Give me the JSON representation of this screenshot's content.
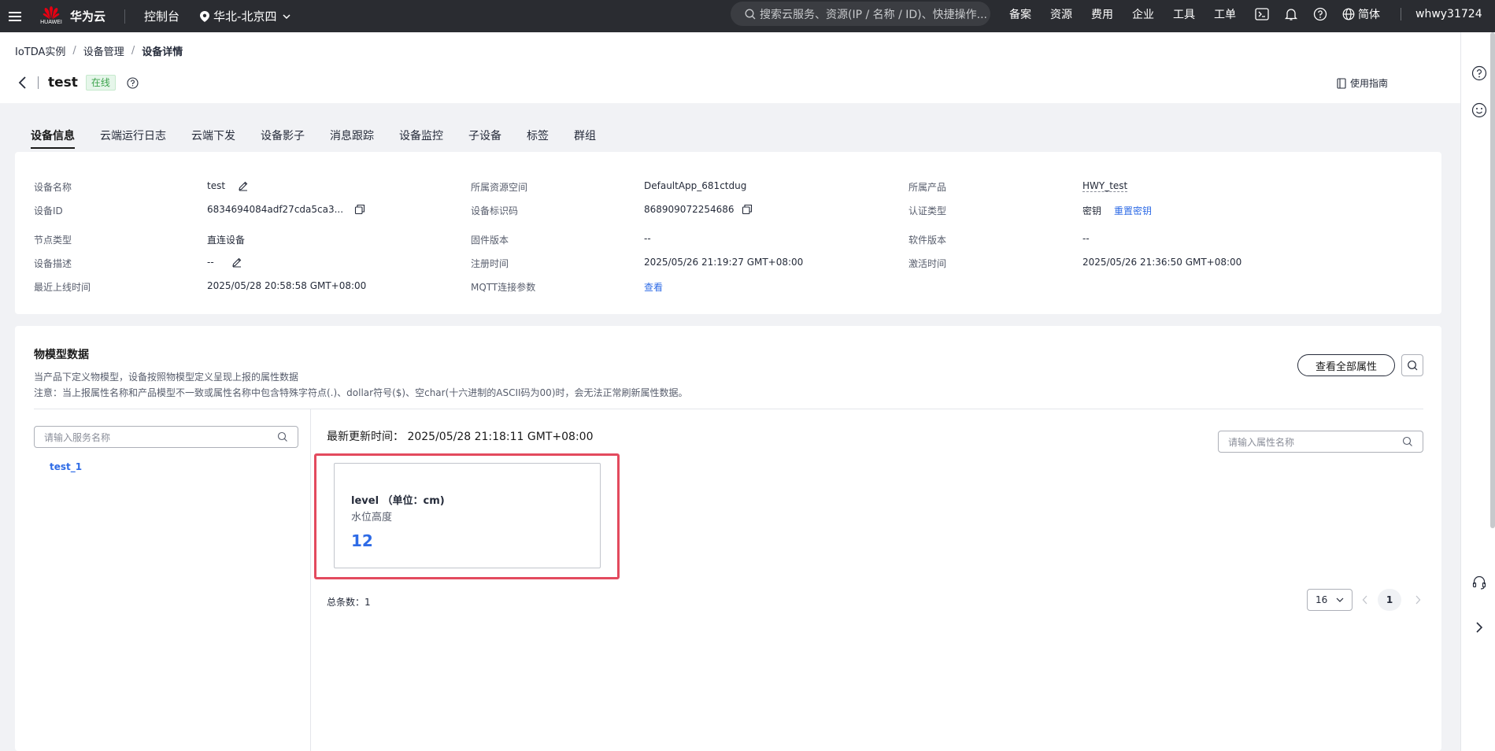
{
  "topbar": {
    "logo_sub": "HUAWEI",
    "logo_text": "华为云",
    "console": "控制台",
    "region": "华北-北京四",
    "search_placeholder": "搜索云服务、资源(IP / 名称 / ID)、快捷操作...",
    "links": [
      "备案",
      "资源",
      "费用",
      "企业",
      "工具",
      "工单"
    ],
    "lang": "简体",
    "user": "whwy31724"
  },
  "breadcrumb": [
    "IoTDA实例",
    "设备管理",
    "设备详情"
  ],
  "header": {
    "title": "test",
    "status": "在线",
    "guide": "使用指南"
  },
  "tabs": [
    "设备信息",
    "云端运行日志",
    "云端下发",
    "设备影子",
    "消息跟踪",
    "设备监控",
    "子设备",
    "标签",
    "群组"
  ],
  "device_info": {
    "name_label": "设备名称",
    "name": "test",
    "id_label": "设备ID",
    "id": "6834694084adf27cda5ca3...",
    "node_label": "节点类型",
    "node": "直连设备",
    "desc_label": "设备描述",
    "desc": "--",
    "last_online_label": "最近上线时间",
    "last_online": "2025/05/28 20:58:58 GMT+08:00",
    "space_label": "所属资源空间",
    "space": "DefaultApp_681ctdug",
    "ident_label": "设备标识码",
    "ident": "868909072254686",
    "fw_label": "固件版本",
    "fw": "--",
    "reg_label": "注册时间",
    "reg": "2025/05/26 21:19:27 GMT+08:00",
    "mqtt_label": "MQTT连接参数",
    "mqtt": "查看",
    "product_label": "所属产品",
    "product": "HWY_test",
    "auth_label": "认证类型",
    "auth": "密钥",
    "reset": "重置密钥",
    "sw_label": "软件版本",
    "sw": "--",
    "active_label": "激活时间",
    "active": "2025/05/26 21:36:50 GMT+08:00"
  },
  "model": {
    "title": "物模型数据",
    "desc": "当产品下定义物模型，设备按照物模型定义呈现上报的属性数据",
    "note": "注意：当上报属性名称和产品模型不一致或属性名称中包含特殊字符点(.)、dollar符号($)、空char(十六进制的ASCII码为00)时，会无法正常刷新属性数据。",
    "view_all": "查看全部属性",
    "service_placeholder": "请输入服务名称",
    "service": "test_1",
    "update_time": "最新更新时间：  2025/05/28 21:18:11 GMT+08:00",
    "prop_placeholder": "请输入属性名称",
    "prop_name": "level （单位：cm)",
    "prop_desc": "水位高度",
    "prop_value": "12",
    "total": "总条数：1",
    "page_size": "16",
    "page": "1"
  }
}
